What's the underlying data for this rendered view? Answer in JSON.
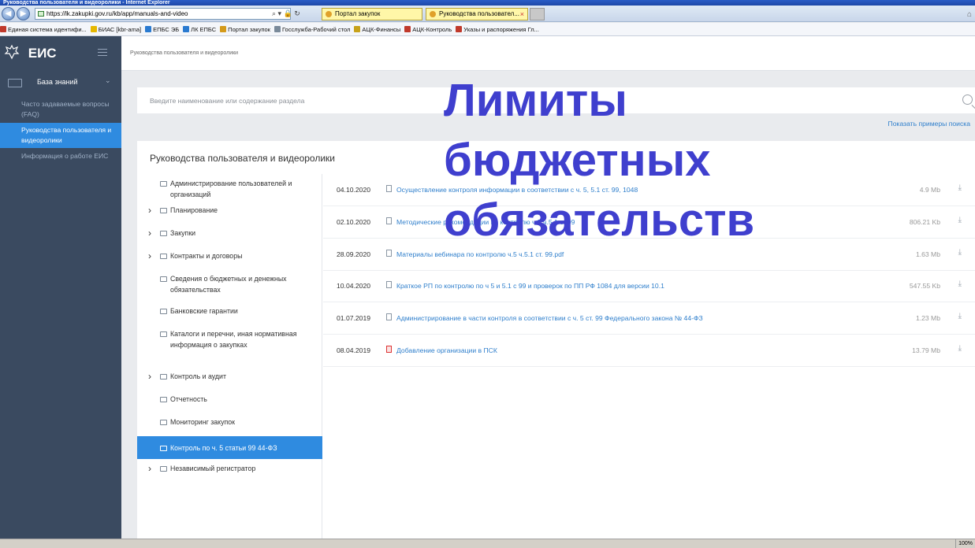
{
  "browser": {
    "title": "Руководства пользователя и видеоролики - Internet Explorer",
    "address": "https://lk.zakupki.gov.ru/kb/app/manuals-and-video",
    "tabs": [
      {
        "label": "Портал закупок"
      },
      {
        "label": "Руководства пользовател...",
        "close": "×"
      }
    ],
    "favorites": [
      {
        "label": "Единая система идентифи...",
        "color": "#c0392b"
      },
      {
        "label": "БИАС [kbr-ama]",
        "color": "#e6b800"
      },
      {
        "label": "ЕПБС ЭБ",
        "color": "#2a7ad0"
      },
      {
        "label": "ЛК ЕПБС",
        "color": "#2a7ad0"
      },
      {
        "label": "Портал закупок",
        "color": "#d49a1a"
      },
      {
        "label": "Госслужба-Рабочий стол",
        "color": "#7a8a9a"
      },
      {
        "label": "АЦК-Финансы",
        "color": "#c7a21a"
      },
      {
        "label": "АЦК-Контроль",
        "color": "#c0392b"
      },
      {
        "label": "Указы и распоряжения Гл...",
        "color": "#c0392b"
      }
    ],
    "zoom": "100%"
  },
  "sidebar": {
    "logo": "ЕИС",
    "section": "База знаний",
    "items": [
      {
        "label": "Часто задаваемые вопросы (FAQ)"
      },
      {
        "label": "Руководства пользователя и видеоролики"
      },
      {
        "label": "Информация о работе ЕИС"
      }
    ]
  },
  "header": {
    "breadcrumb": "Руководства пользователя и видеоролики"
  },
  "search": {
    "placeholder": "Введите наименование или содержание раздела",
    "examples_link": "Показать примеры поиска"
  },
  "content": {
    "title": "Руководства пользователя и видеоролики",
    "tree": [
      {
        "label": "Администрирование пользователей и организаций",
        "expandable": false
      },
      {
        "label": "Планирование",
        "expandable": true
      },
      {
        "label": "Закупки",
        "expandable": true
      },
      {
        "label": "Контракты и договоры",
        "expandable": true
      },
      {
        "label": "Сведения о бюджетных и денежных обязательствах",
        "expandable": false
      },
      {
        "label": "Банковские гарантии",
        "expandable": false
      },
      {
        "label": "Каталоги и перечни, иная нормативная информация о закупках",
        "expandable": false
      },
      {
        "label": "Контроль и аудит",
        "expandable": true
      },
      {
        "label": "Отчетность",
        "expandable": false
      },
      {
        "label": "Мониторинг закупок",
        "expandable": false
      },
      {
        "label": "Контроль по ч. 5 статьи 99 44-ФЗ",
        "expandable": false
      },
      {
        "label": "Независимый регистратор",
        "expandable": true
      }
    ],
    "documents": [
      {
        "date": "04.10.2020",
        "title": "Осуществление контроля информации в соответствии с ч. 5, 5.1 ст. 99, 1048",
        "size": "4.9 Mb"
      },
      {
        "date": "02.10.2020",
        "title": "Методические рекомендации по контролю ч.5 ч.5.1 ст.99",
        "size": "806.21 Kb"
      },
      {
        "date": "28.09.2020",
        "title": "Материалы вебинара по контролю ч.5 ч.5.1 ст. 99.pdf",
        "size": "1.63 Mb"
      },
      {
        "date": "10.04.2020",
        "title": "Краткое РП по контролю по ч 5 и 5.1 с 99 и проверок по ПП РФ 1084 для версии 10.1",
        "size": "547.55 Kb"
      },
      {
        "date": "01.07.2019",
        "title": "Администрирование в части контроля в соответствии с ч. 5 ст. 99 Федерального закона № 44-ФЗ",
        "size": "1.23 Mb"
      },
      {
        "date": "08.04.2019",
        "title": "Добавление организации в ПСК",
        "size": "13.79 Mb"
      }
    ]
  },
  "overlay": {
    "line1": "Лимиты",
    "line2": "бюджетных",
    "line3": "обязательств"
  },
  "colors": {
    "sidebar_bg": "#3a4a60",
    "accent": "#2f8be0",
    "link": "#2f7fcc",
    "overlay_text": "#3f3fce"
  }
}
